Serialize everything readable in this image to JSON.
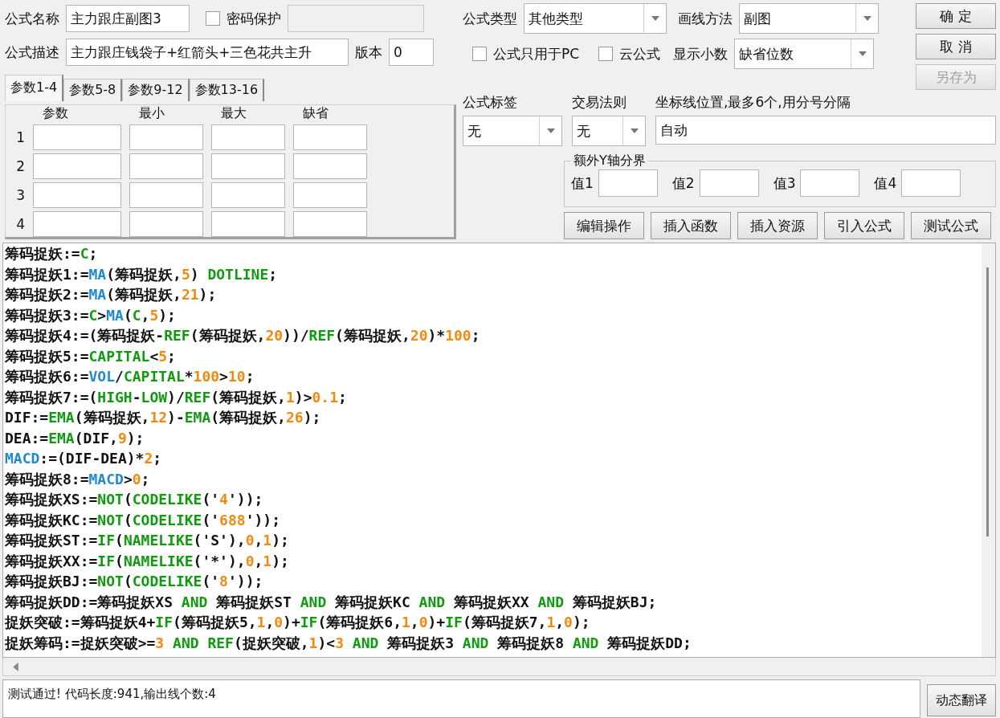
{
  "form": {
    "name_label": "公式名称",
    "name": "主力跟庄副图3",
    "password": {
      "label": "密码保护",
      "checked": false
    },
    "desc_label": "公式描述",
    "description": "主力跟庄钱袋子+红箭头+三色花共主升",
    "version_label": "版本",
    "version": "0"
  },
  "tabs": [
    {
      "label": "参数1-4",
      "selected": true
    },
    {
      "label": "参数5-8",
      "selected": false
    },
    {
      "label": "参数9-12",
      "selected": false
    },
    {
      "label": "参数13-16",
      "selected": false
    }
  ],
  "params": {
    "columns": [
      "参数",
      "最小",
      "最大",
      "缺省"
    ],
    "rows": [
      "1",
      "2",
      "3",
      "4"
    ]
  },
  "type": {
    "label": "公式类型",
    "value": "其他类型"
  },
  "draw": {
    "label": "画线方法",
    "value": "副图"
  },
  "pc_only": {
    "label": "公式只用于PC",
    "checked": false
  },
  "cloud": {
    "label": "云公式",
    "checked": false
  },
  "decimals": {
    "label": "显示小数",
    "value": "缺省位数"
  },
  "buttons": [
    {
      "label": "确 定",
      "disabled": false
    },
    {
      "label": "取 消",
      "disabled": false
    },
    {
      "label": "另存为",
      "disabled": true
    }
  ],
  "tag": {
    "label": "公式标签",
    "value": "无"
  },
  "rule": {
    "label": "交易法则",
    "value": "无"
  },
  "axis": {
    "label": "坐标线位置,最多6个,用分号分隔",
    "value": "自动"
  },
  "y_bounds": {
    "title": "额外Y轴分界",
    "fields": [
      "值1",
      "值2",
      "值3",
      "值4"
    ]
  },
  "tools": [
    "编辑操作",
    "插入函数",
    "插入资源",
    "引入公式",
    "测试公式"
  ],
  "code": [
    [
      {
        "text": "筹码捉妖:=",
        "kind": "plain"
      },
      {
        "text": "C",
        "kind": "func"
      },
      {
        "text": ";",
        "kind": "plain"
      }
    ],
    [
      {
        "text": "筹码捉妖1:=",
        "kind": "plain"
      },
      {
        "text": "MA",
        "kind": "var"
      },
      {
        "text": "(筹码捉妖,",
        "kind": "plain"
      },
      {
        "text": "5",
        "kind": "num"
      },
      {
        "text": ") ",
        "kind": "plain"
      },
      {
        "text": "DOTLINE",
        "kind": "func"
      },
      {
        "text": ";",
        "kind": "plain"
      }
    ],
    [
      {
        "text": "筹码捉妖2:=",
        "kind": "plain"
      },
      {
        "text": "MA",
        "kind": "var"
      },
      {
        "text": "(筹码捉妖,",
        "kind": "plain"
      },
      {
        "text": "21",
        "kind": "num"
      },
      {
        "text": ");",
        "kind": "plain"
      }
    ],
    [
      {
        "text": "筹码捉妖3:=",
        "kind": "plain"
      },
      {
        "text": "C",
        "kind": "func"
      },
      {
        "text": ">",
        "kind": "plain"
      },
      {
        "text": "MA",
        "kind": "var"
      },
      {
        "text": "(",
        "kind": "plain"
      },
      {
        "text": "C",
        "kind": "func"
      },
      {
        "text": ",",
        "kind": "plain"
      },
      {
        "text": "5",
        "kind": "num"
      },
      {
        "text": ");",
        "kind": "plain"
      }
    ],
    [
      {
        "text": "筹码捉妖4:=(筹码捉妖-",
        "kind": "plain"
      },
      {
        "text": "REF",
        "kind": "func"
      },
      {
        "text": "(筹码捉妖,",
        "kind": "plain"
      },
      {
        "text": "20",
        "kind": "num"
      },
      {
        "text": "))/",
        "kind": "plain"
      },
      {
        "text": "REF",
        "kind": "func"
      },
      {
        "text": "(筹码捉妖,",
        "kind": "plain"
      },
      {
        "text": "20",
        "kind": "num"
      },
      {
        "text": ")*",
        "kind": "plain"
      },
      {
        "text": "100",
        "kind": "num"
      },
      {
        "text": ";",
        "kind": "plain"
      }
    ],
    [
      {
        "text": "筹码捉妖5:=",
        "kind": "plain"
      },
      {
        "text": "CAPITAL",
        "kind": "func"
      },
      {
        "text": "<",
        "kind": "plain"
      },
      {
        "text": "5",
        "kind": "num"
      },
      {
        "text": ";",
        "kind": "plain"
      }
    ],
    [
      {
        "text": "筹码捉妖6:=",
        "kind": "plain"
      },
      {
        "text": "VOL",
        "kind": "var"
      },
      {
        "text": "/",
        "kind": "plain"
      },
      {
        "text": "CAPITAL",
        "kind": "func"
      },
      {
        "text": "*",
        "kind": "plain"
      },
      {
        "text": "100",
        "kind": "num"
      },
      {
        "text": ">",
        "kind": "plain"
      },
      {
        "text": "10",
        "kind": "num"
      },
      {
        "text": ";",
        "kind": "plain"
      }
    ],
    [
      {
        "text": "筹码捉妖7:=(",
        "kind": "plain"
      },
      {
        "text": "HIGH",
        "kind": "func"
      },
      {
        "text": "-",
        "kind": "plain"
      },
      {
        "text": "LOW",
        "kind": "func"
      },
      {
        "text": ")/",
        "kind": "plain"
      },
      {
        "text": "REF",
        "kind": "func"
      },
      {
        "text": "(筹码捉妖,",
        "kind": "plain"
      },
      {
        "text": "1",
        "kind": "num"
      },
      {
        "text": ")>",
        "kind": "plain"
      },
      {
        "text": "0.1",
        "kind": "num"
      },
      {
        "text": ";",
        "kind": "plain"
      }
    ],
    [
      {
        "text": "DIF:=",
        "kind": "plain"
      },
      {
        "text": "EMA",
        "kind": "func"
      },
      {
        "text": "(筹码捉妖,",
        "kind": "plain"
      },
      {
        "text": "12",
        "kind": "num"
      },
      {
        "text": ")-",
        "kind": "plain"
      },
      {
        "text": "EMA",
        "kind": "func"
      },
      {
        "text": "(筹码捉妖,",
        "kind": "plain"
      },
      {
        "text": "26",
        "kind": "num"
      },
      {
        "text": ");",
        "kind": "plain"
      }
    ],
    [
      {
        "text": "DEA:=",
        "kind": "plain"
      },
      {
        "text": "EMA",
        "kind": "func"
      },
      {
        "text": "(DIF,",
        "kind": "plain"
      },
      {
        "text": "9",
        "kind": "num"
      },
      {
        "text": ");",
        "kind": "plain"
      }
    ],
    [
      {
        "text": "MACD",
        "kind": "var"
      },
      {
        "text": ":=(DIF-DEA)*",
        "kind": "plain"
      },
      {
        "text": "2",
        "kind": "num"
      },
      {
        "text": ";",
        "kind": "plain"
      }
    ],
    [
      {
        "text": "筹码捉妖8:=",
        "kind": "plain"
      },
      {
        "text": "MACD",
        "kind": "var"
      },
      {
        "text": ">",
        "kind": "plain"
      },
      {
        "text": "0",
        "kind": "num"
      },
      {
        "text": ";",
        "kind": "plain"
      }
    ],
    [
      {
        "text": "筹码捉妖XS:=",
        "kind": "plain"
      },
      {
        "text": "NOT",
        "kind": "func"
      },
      {
        "text": "(",
        "kind": "plain"
      },
      {
        "text": "CODELIKE",
        "kind": "func"
      },
      {
        "text": "('",
        "kind": "plain"
      },
      {
        "text": "4",
        "kind": "num"
      },
      {
        "text": "'));",
        "kind": "plain"
      }
    ],
    [
      {
        "text": "筹码捉妖KC:=",
        "kind": "plain"
      },
      {
        "text": "NOT",
        "kind": "func"
      },
      {
        "text": "(",
        "kind": "plain"
      },
      {
        "text": "CODELIKE",
        "kind": "func"
      },
      {
        "text": "('",
        "kind": "plain"
      },
      {
        "text": "688",
        "kind": "num"
      },
      {
        "text": "'));",
        "kind": "plain"
      }
    ],
    [
      {
        "text": "筹码捉妖ST:=",
        "kind": "plain"
      },
      {
        "text": "IF",
        "kind": "func"
      },
      {
        "text": "(",
        "kind": "plain"
      },
      {
        "text": "NAMELIKE",
        "kind": "func"
      },
      {
        "text": "('S'),",
        "kind": "plain"
      },
      {
        "text": "0",
        "kind": "num"
      },
      {
        "text": ",",
        "kind": "plain"
      },
      {
        "text": "1",
        "kind": "num"
      },
      {
        "text": ");",
        "kind": "plain"
      }
    ],
    [
      {
        "text": "筹码捉妖XX:=",
        "kind": "plain"
      },
      {
        "text": "IF",
        "kind": "func"
      },
      {
        "text": "(",
        "kind": "plain"
      },
      {
        "text": "NAMELIKE",
        "kind": "func"
      },
      {
        "text": "('*'),",
        "kind": "plain"
      },
      {
        "text": "0",
        "kind": "num"
      },
      {
        "text": ",",
        "kind": "plain"
      },
      {
        "text": "1",
        "kind": "num"
      },
      {
        "text": ");",
        "kind": "plain"
      }
    ],
    [
      {
        "text": "筹码捉妖BJ:=",
        "kind": "plain"
      },
      {
        "text": "NOT",
        "kind": "func"
      },
      {
        "text": "(",
        "kind": "plain"
      },
      {
        "text": "CODELIKE",
        "kind": "func"
      },
      {
        "text": "('",
        "kind": "plain"
      },
      {
        "text": "8",
        "kind": "num"
      },
      {
        "text": "'));",
        "kind": "plain"
      }
    ],
    [
      {
        "text": "筹码捉妖DD:=筹码捉妖XS ",
        "kind": "plain"
      },
      {
        "text": "AND",
        "kind": "func"
      },
      {
        "text": " 筹码捉妖ST ",
        "kind": "plain"
      },
      {
        "text": "AND",
        "kind": "func"
      },
      {
        "text": " 筹码捉妖KC ",
        "kind": "plain"
      },
      {
        "text": "AND",
        "kind": "func"
      },
      {
        "text": " 筹码捉妖XX ",
        "kind": "plain"
      },
      {
        "text": "AND",
        "kind": "func"
      },
      {
        "text": " 筹码捉妖BJ;",
        "kind": "plain"
      }
    ],
    [
      {
        "text": "捉妖突破:=筹码捉妖4+",
        "kind": "plain"
      },
      {
        "text": "IF",
        "kind": "func"
      },
      {
        "text": "(筹码捉妖5,",
        "kind": "plain"
      },
      {
        "text": "1",
        "kind": "num"
      },
      {
        "text": ",",
        "kind": "plain"
      },
      {
        "text": "0",
        "kind": "num"
      },
      {
        "text": ")+",
        "kind": "plain"
      },
      {
        "text": "IF",
        "kind": "func"
      },
      {
        "text": "(筹码捉妖6,",
        "kind": "plain"
      },
      {
        "text": "1",
        "kind": "num"
      },
      {
        "text": ",",
        "kind": "plain"
      },
      {
        "text": "0",
        "kind": "num"
      },
      {
        "text": ")+",
        "kind": "plain"
      },
      {
        "text": "IF",
        "kind": "func"
      },
      {
        "text": "(筹码捉妖7,",
        "kind": "plain"
      },
      {
        "text": "1",
        "kind": "num"
      },
      {
        "text": ",",
        "kind": "plain"
      },
      {
        "text": "0",
        "kind": "num"
      },
      {
        "text": ");",
        "kind": "plain"
      }
    ],
    [
      {
        "text": "捉妖筹码:=捉妖突破>=",
        "kind": "plain"
      },
      {
        "text": "3",
        "kind": "num"
      },
      {
        "text": " AND",
        "kind": "func"
      },
      {
        "text": " REF",
        "kind": "func"
      },
      {
        "text": "(捉妖突破,",
        "kind": "plain"
      },
      {
        "text": "1",
        "kind": "num"
      },
      {
        "text": ")<",
        "kind": "plain"
      },
      {
        "text": "3",
        "kind": "num"
      },
      {
        "text": " AND",
        "kind": "func"
      },
      {
        "text": " 筹码捉妖3 ",
        "kind": "plain"
      },
      {
        "text": "AND",
        "kind": "func"
      },
      {
        "text": " 筹码捉妖8 ",
        "kind": "plain"
      },
      {
        "text": "AND",
        "kind": "func"
      },
      {
        "text": " 筹码捉妖DD;",
        "kind": "plain"
      }
    ]
  ],
  "status": "测试通过! 代码长度:941,输出线个数:4",
  "translate_button": "动态翻译"
}
